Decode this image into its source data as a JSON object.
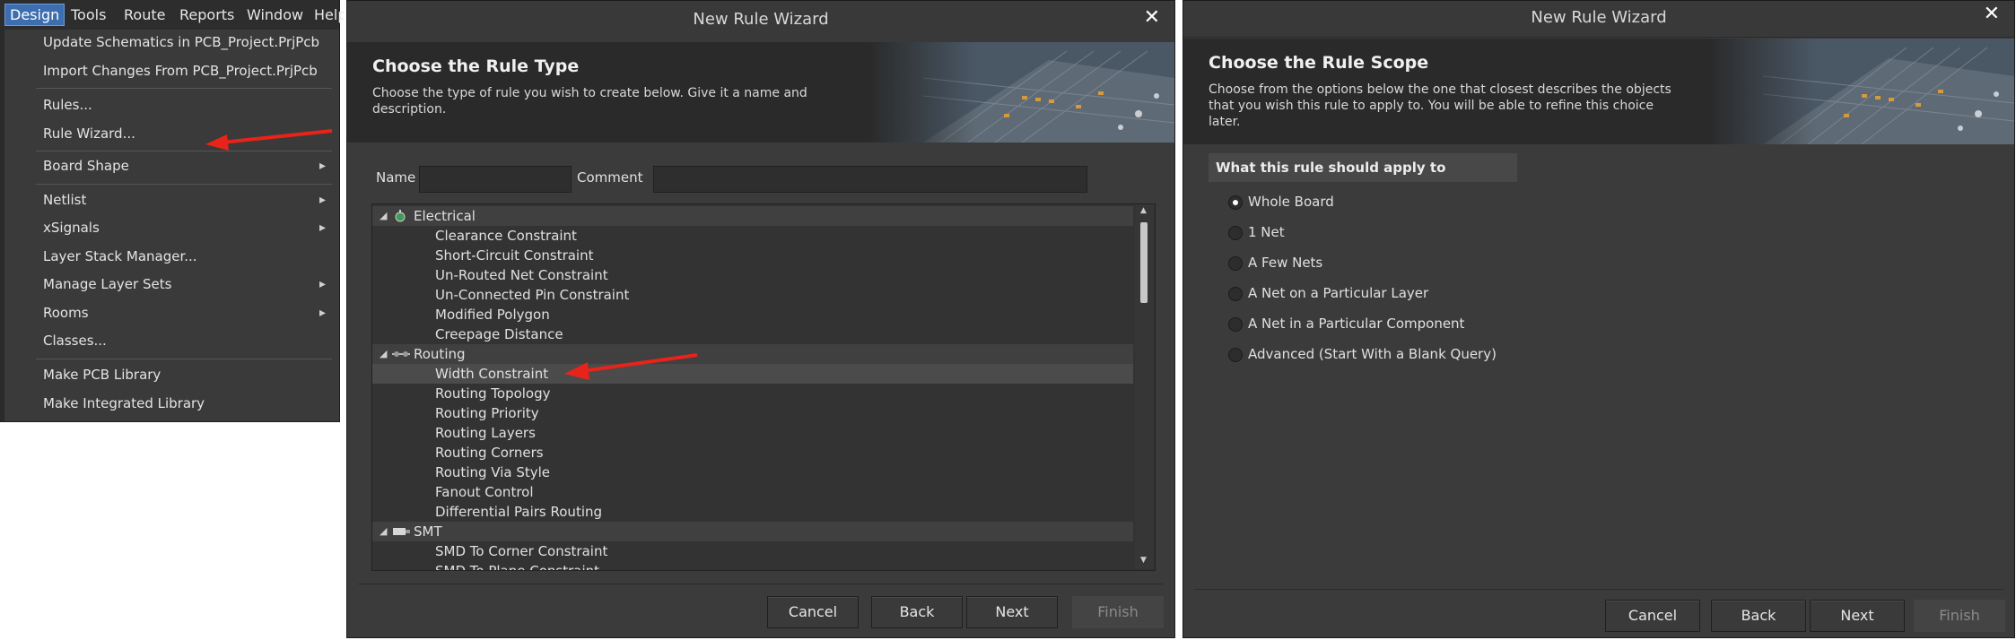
{
  "menubar": {
    "items": [
      "Design",
      "Tools",
      "Route",
      "Reports",
      "Window",
      "Help"
    ]
  },
  "design_menu": {
    "items": [
      {
        "label": "Update Schematics in PCB_Project.PrjPcb",
        "submenu": false
      },
      {
        "label": "Import Changes From PCB_Project.PrjPcb",
        "submenu": false
      },
      {
        "label": "Rules...",
        "submenu": false
      },
      {
        "label": "Rule Wizard...",
        "submenu": false
      },
      {
        "label": "Board Shape",
        "submenu": true
      },
      {
        "label": "Netlist",
        "submenu": true
      },
      {
        "label": "xSignals",
        "submenu": true
      },
      {
        "label": "Layer Stack Manager...",
        "submenu": false
      },
      {
        "label": "Manage Layer Sets",
        "submenu": true
      },
      {
        "label": "Rooms",
        "submenu": true
      },
      {
        "label": "Classes...",
        "submenu": false
      },
      {
        "label": "Make PCB Library",
        "submenu": false
      },
      {
        "label": "Make Integrated Library",
        "submenu": false
      }
    ]
  },
  "rule_type_dialog": {
    "window_title": "New Rule Wizard",
    "heading": "Choose the Rule Type",
    "description": "Choose the type of rule you wish to create below. Give it a name and description.",
    "name_label": "Name",
    "name_value": "",
    "comment_label": "Comment",
    "comment_value": "",
    "tree": [
      {
        "type": "category",
        "label": "Electrical",
        "icon": "electrical-icon"
      },
      {
        "type": "item",
        "label": "Clearance Constraint"
      },
      {
        "type": "item",
        "label": "Short-Circuit Constraint"
      },
      {
        "type": "item",
        "label": "Un-Routed Net Constraint"
      },
      {
        "type": "item",
        "label": "Un-Connected Pin Constraint"
      },
      {
        "type": "item",
        "label": "Modified Polygon"
      },
      {
        "type": "item",
        "label": "Creepage Distance"
      },
      {
        "type": "category",
        "label": "Routing",
        "icon": "routing-icon"
      },
      {
        "type": "item",
        "label": "Width Constraint",
        "selected": true
      },
      {
        "type": "item",
        "label": "Routing Topology"
      },
      {
        "type": "item",
        "label": "Routing Priority"
      },
      {
        "type": "item",
        "label": "Routing Layers"
      },
      {
        "type": "item",
        "label": "Routing Corners"
      },
      {
        "type": "item",
        "label": "Routing Via Style"
      },
      {
        "type": "item",
        "label": "Fanout Control"
      },
      {
        "type": "item",
        "label": "Differential Pairs Routing"
      },
      {
        "type": "category",
        "label": "SMT",
        "icon": "smt-icon"
      },
      {
        "type": "item",
        "label": "SMD To Corner Constraint"
      },
      {
        "type": "item",
        "label": "SMD To Plane Constraint"
      }
    ],
    "buttons": {
      "cancel": "Cancel",
      "back": "Back",
      "next": "Next",
      "finish": "Finish"
    }
  },
  "rule_scope_dialog": {
    "window_title": "New Rule Wizard",
    "heading": "Choose the Rule Scope",
    "description": "Choose from the options below the one that closest describes the objects that you wish this rule to apply to. You will be able to refine this choice later.",
    "group_header": "What this rule should apply to",
    "options": [
      {
        "label": "Whole Board",
        "checked": true
      },
      {
        "label": "1 Net",
        "checked": false
      },
      {
        "label": "A Few Nets",
        "checked": false
      },
      {
        "label": "A Net on a Particular Layer",
        "checked": false
      },
      {
        "label": "A Net in a Particular Component",
        "checked": false
      },
      {
        "label": "Advanced (Start With a Blank Query)",
        "checked": false
      }
    ],
    "buttons": {
      "cancel": "Cancel",
      "back": "Back",
      "next": "Next",
      "finish": "Finish"
    }
  },
  "colors": {
    "dialog_bg": "#3b3b3b",
    "banner_bg": "#2a2a2a",
    "menu_highlight": "#3d6fb0",
    "annotation_arrow": "#e8231a"
  }
}
